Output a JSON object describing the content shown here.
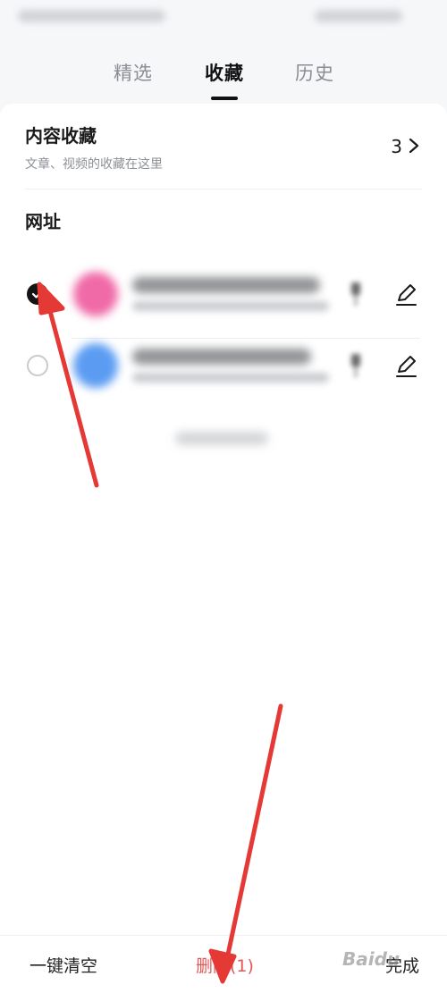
{
  "tabs": [
    {
      "label": "精选",
      "active": false
    },
    {
      "label": "收藏",
      "active": true
    },
    {
      "label": "历史",
      "active": false
    }
  ],
  "content_favorites": {
    "title": "内容收藏",
    "subtitle": "文章、视频的收藏在这里",
    "count": "3"
  },
  "urls_section": {
    "label": "网址",
    "items": [
      {
        "selected": true,
        "icon_color": "#f06aa8"
      },
      {
        "selected": false,
        "icon_color": "#5b9cf2"
      }
    ]
  },
  "bottom_bar": {
    "clear_label": "一键清空",
    "delete_label": "删除(1)",
    "done_label": "完成"
  },
  "watermark": "Baidu",
  "colors": {
    "delete": "#e2585a",
    "annotation_arrow": "#e53935",
    "active_tab": "#111111"
  }
}
